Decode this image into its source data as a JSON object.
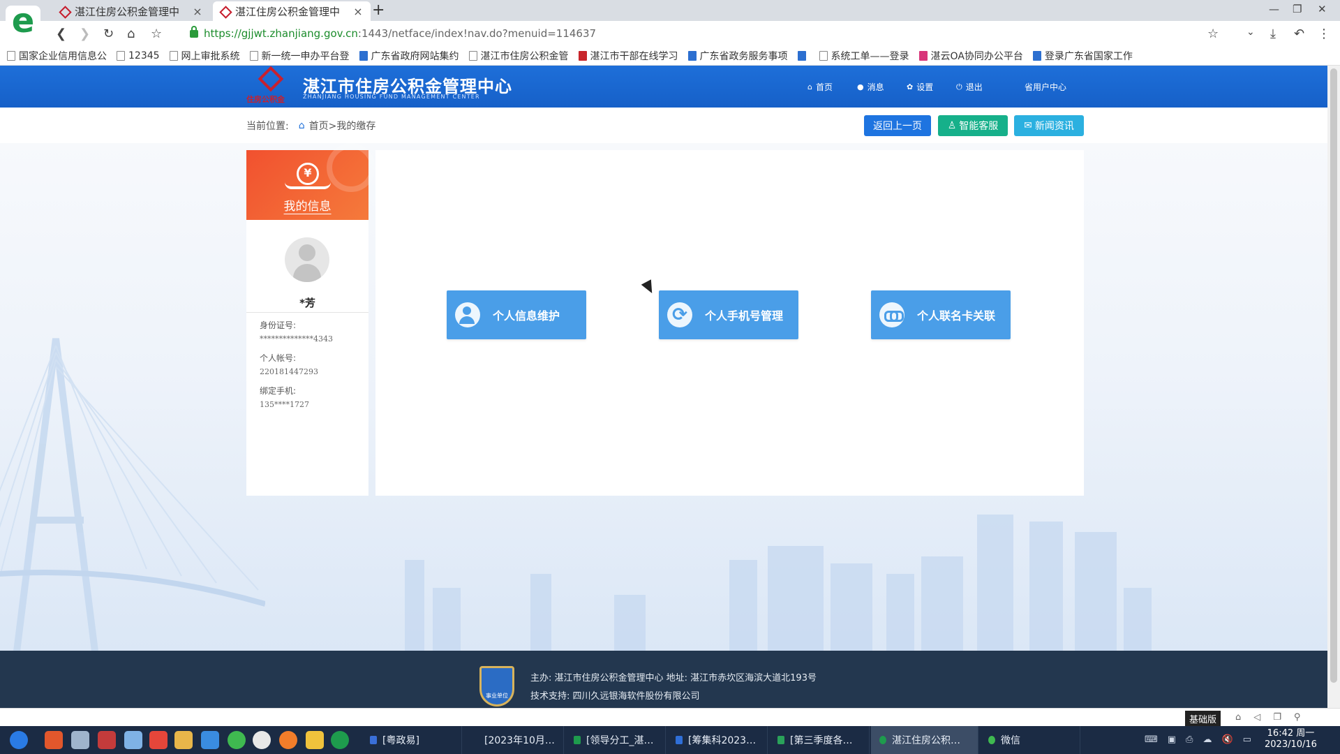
{
  "browser": {
    "logo": "e",
    "tabs": [
      {
        "title": "湛江住房公积金管理中"
      },
      {
        "title": "湛江住房公积金管理中"
      }
    ],
    "new_tab": "+",
    "url_secure": "https://gjjwt.zhanjiang.gov.cn",
    "url_rest": ":1443/netface/index!nav.do?menuid=114637",
    "bookmarks": [
      {
        "label": "国家企业信用信息公"
      },
      {
        "label": "12345"
      },
      {
        "label": "网上审批系统"
      },
      {
        "label": "新一统一申办平台登"
      },
      {
        "label": "广东省政府网站集约"
      },
      {
        "label": "湛江市住房公积金管"
      },
      {
        "label": "湛江市干部在线学习"
      },
      {
        "label": "广东省政务服务事项"
      },
      {
        "label": "系统工单——登录"
      },
      {
        "label": "湛云OA协同办公平台"
      },
      {
        "label": "登录广东省国家工作"
      }
    ]
  },
  "site": {
    "title": "湛江市住房公积金管理中心",
    "subtitle": "ZHANJIANG HOUSING FUND MANAGEMENT CENTER",
    "logo_caption": "住房公积金",
    "nav": [
      {
        "icon": "home-icon",
        "glyph": "⌂",
        "label": "首页"
      },
      {
        "icon": "message-icon",
        "glyph": "●",
        "label": "消息"
      },
      {
        "icon": "gear-icon",
        "glyph": "✿",
        "label": "设置"
      },
      {
        "icon": "power-icon",
        "glyph": "⏻",
        "label": "退出"
      }
    ],
    "user_center": "省用户中心"
  },
  "breadcrumb": {
    "prefix": "当前位置:",
    "home": "首页",
    "current": ">我的缴存"
  },
  "actions": {
    "back": "返回上一页",
    "service": "智能客服",
    "news": "新闻资讯"
  },
  "sidebar": {
    "header_label": "我的信息",
    "name": "*芳",
    "fields": [
      {
        "label": "身份证号:",
        "value": "**************4343"
      },
      {
        "label": "个人帐号:",
        "value": "220181447293"
      },
      {
        "label": "绑定手机:",
        "value": "135****1727"
      }
    ]
  },
  "functions": [
    {
      "icon": "user-settings-icon",
      "label": "个人信息维护"
    },
    {
      "icon": "sync-icon",
      "label": "个人手机号管理"
    },
    {
      "icon": "link-icon",
      "label": "个人联名卡关联"
    }
  ],
  "footer": {
    "badge": "事业单位",
    "line1": "主办: 湛江市住房公积金管理中心 地址: 湛江市赤坎区海滨大道北193号",
    "line2": "技术支持: 四川久远银海软件股份有限公司"
  },
  "status": {
    "mode": "基础版"
  },
  "taskbar": {
    "tasks": [
      {
        "label": "[粤政易]"
      },
      {
        "label": "[2023年10月…"
      },
      {
        "label": "[领导分工_湛…"
      },
      {
        "label": "[筹集科2023…"
      },
      {
        "label": "[第三季度各…"
      },
      {
        "label": "湛江住房公积…"
      },
      {
        "label": "微信"
      }
    ],
    "time": "16:42 周一",
    "date": "2023/10/16"
  }
}
